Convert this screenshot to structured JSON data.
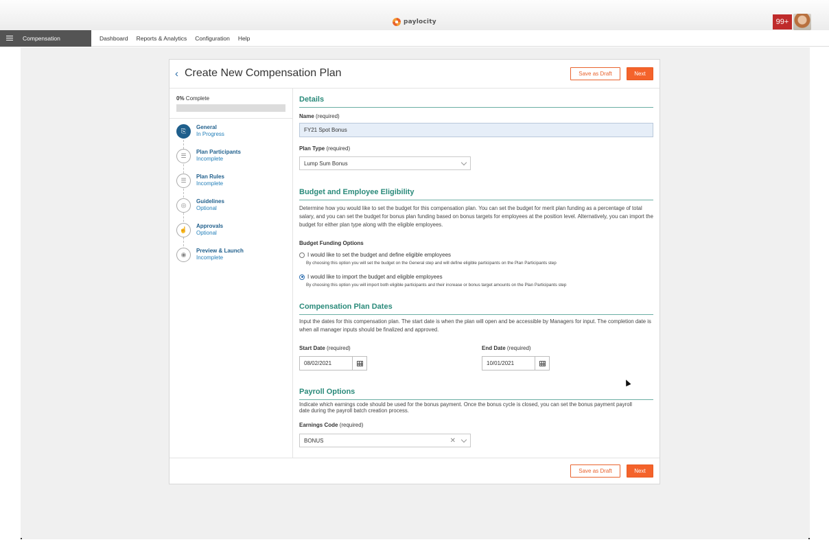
{
  "brand": {
    "logo_text": "paylocity"
  },
  "header": {
    "notifications_badge": "99+"
  },
  "nav": {
    "app_label": "Compensation",
    "links": [
      "Dashboard",
      "Reports & Analytics",
      "Configuration",
      "Help"
    ]
  },
  "page": {
    "title": "Create New Compensation Plan",
    "save_draft_label": "Save as Draft",
    "next_label": "Next"
  },
  "progress": {
    "percent_text": "0%",
    "suffix": " Complete",
    "value": 0
  },
  "steps": [
    {
      "name": "General",
      "status": "In Progress",
      "icon": "clipboard-icon"
    },
    {
      "name": "Plan Participants",
      "status": "Incomplete",
      "icon": "checklist-icon"
    },
    {
      "name": "Plan Rules",
      "status": "Incomplete",
      "icon": "checklist-icon"
    },
    {
      "name": "Guidelines",
      "status": "Optional",
      "icon": "target-icon"
    },
    {
      "name": "Approvals",
      "status": "Optional",
      "icon": "thumbs-up-icon"
    },
    {
      "name": "Preview & Launch",
      "status": "Incomplete",
      "icon": "eye-icon"
    }
  ],
  "details": {
    "section_title": "Details",
    "name_label": "Name",
    "name_req": "(required)",
    "name_value": "FY21 Spot Bonus",
    "plan_type_label": "Plan Type",
    "plan_type_req": "(required)",
    "plan_type_value": "Lump Sum Bonus"
  },
  "budget": {
    "section_title": "Budget and Employee Eligibility",
    "description": "Determine how you would like to set the budget for this compensation plan. You can set the budget for merit plan funding as a percentage of total salary, and you can set the budget for bonus plan funding based on bonus targets for employees at the position level. Alternatively, you can import the budget for either plan type along with the eligible employees.",
    "options_label": "Budget Funding Options",
    "option1_label": "I would like to set the budget and define eligible employees",
    "option1_desc": "By choosing this option you will set the budget on the General step and will define eligible participants on the Plan Participants step",
    "option2_label": "I would like to import the budget and eligible employees",
    "option2_desc": "By choosing this option you will import both eligible participants and their increase or bonus target amounts on the Plan Participants step",
    "selected_option": 2
  },
  "dates": {
    "section_title": "Compensation Plan Dates",
    "description": "Input the dates for this compensation plan. The start date is when the plan will open and be accessible by Managers for input. The completion date is when all manager inputs should be finalized and approved.",
    "start_label": "Start Date",
    "start_req": "(required)",
    "start_value": "08/02/2021",
    "end_label": "End Date",
    "end_req": "(required)",
    "end_value": "10/01/2021"
  },
  "payroll": {
    "section_title": "Payroll Options",
    "description": "Indicate which earnings code should be used for the bonus payment. Once the bonus cycle is closed, you can set the bonus payment payroll date during the payroll batch creation process.",
    "earnings_label": "Earnings Code",
    "earnings_req": "(required)",
    "earnings_value": "BONUS"
  },
  "colors": {
    "accent": "#f4632b",
    "heading": "#2a8a7a",
    "step": "#1f5f8c"
  }
}
